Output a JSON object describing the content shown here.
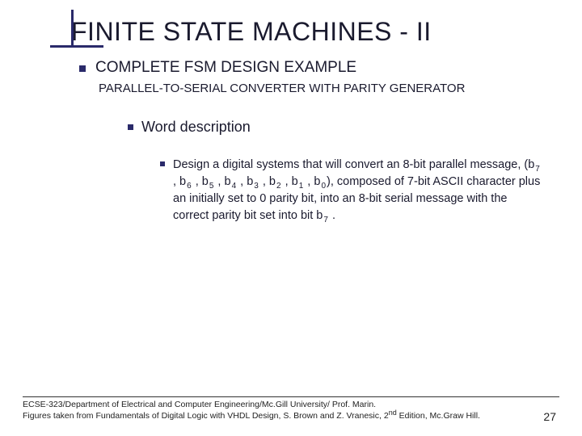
{
  "slide": {
    "title": "FINITE STATE MACHINES - II",
    "bullet1": "COMPLETE FSM DESIGN EXAMPLE",
    "bullet1_sub": "PARALLEL-TO-SERIAL CONVERTER WITH PARITY GENERATOR",
    "bullet2": "Word description",
    "bullet3_pre": "Design a digital systems that will convert an 8-bit parallel message,  (b",
    "bullet3_mid": "), composed of 7-bit ASCII character plus an initially set to  0 parity bit,  into an 8-bit serial message with the correct parity bit set into bit  b",
    "bullet3_end": " .",
    "bits": [
      "7",
      "6",
      "5",
      "4",
      "3",
      "2",
      "1",
      "0"
    ],
    "bit_sep": " , b",
    "last_bit": "7"
  },
  "footer": {
    "line1": "ECSE-323/Department of Electrical and Computer Engineering/Mc.Gill University/ Prof. Marin.",
    "line2_a": "Figures taken from Fundamentals of Digital Logic with VHDL Design, S. Brown and Z. Vranesic, 2",
    "line2_sup": "nd",
    "line2_b": " Edition, Mc.Graw Hill.",
    "page": "27"
  }
}
